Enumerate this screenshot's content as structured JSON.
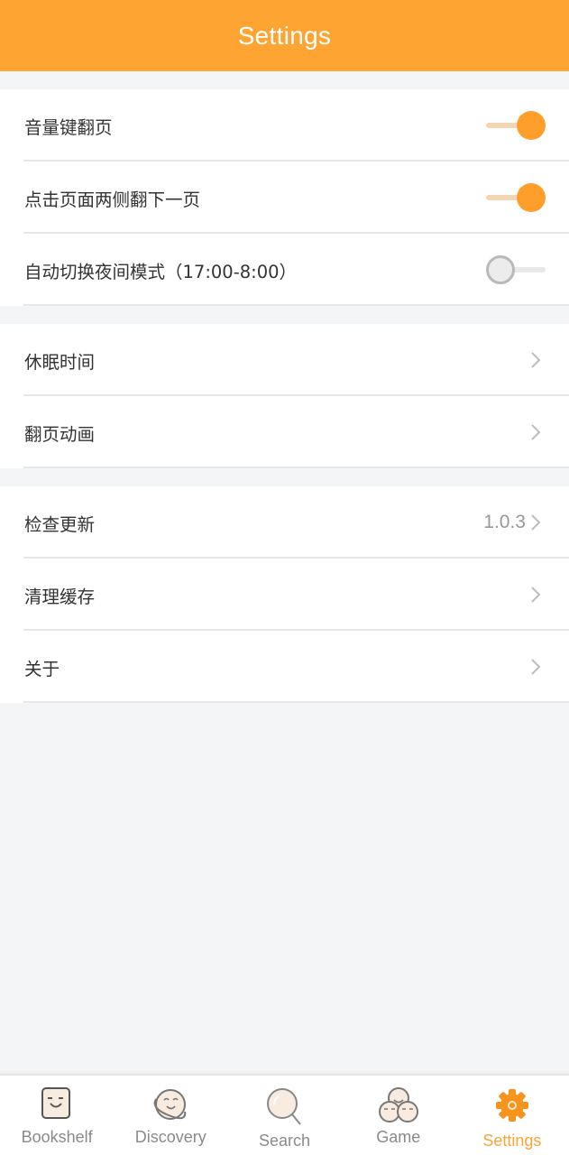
{
  "header": {
    "title": "Settings"
  },
  "colors": {
    "accent": "#fea433",
    "switch_on": "#fe9f2b",
    "switch_track_on": "#f2d6b5",
    "background": "#f4f5f7"
  },
  "groups": [
    {
      "items": [
        {
          "label": "音量键翻页",
          "control": "switch",
          "on": true
        },
        {
          "label": "点击页面两侧翻下一页",
          "control": "switch",
          "on": true
        },
        {
          "label": "自动切换夜间模式（17:00-8:00）",
          "control": "switch",
          "on": false
        }
      ]
    },
    {
      "items": [
        {
          "label": "休眠时间",
          "control": "chevron-right-icon"
        },
        {
          "label": "翻页动画",
          "control": "chevron-right-icon"
        }
      ]
    },
    {
      "items": [
        {
          "label": "检查更新",
          "value": "1.0.3",
          "control": "chevron-right-icon"
        },
        {
          "label": "清理缓存",
          "control": "chevron-right-icon"
        },
        {
          "label": "关于",
          "control": "chevron-right-icon"
        }
      ]
    }
  ],
  "tabbar": {
    "active": "Settings",
    "items": [
      {
        "label": "Bookshelf",
        "icon": "bookshelf-face-icon"
      },
      {
        "label": "Discovery",
        "icon": "planet-face-icon"
      },
      {
        "label": "Search",
        "icon": "magnifier-icon"
      },
      {
        "label": "Game",
        "icon": "three-faces-icon"
      },
      {
        "label": "Settings",
        "icon": "gear-icon"
      }
    ]
  }
}
